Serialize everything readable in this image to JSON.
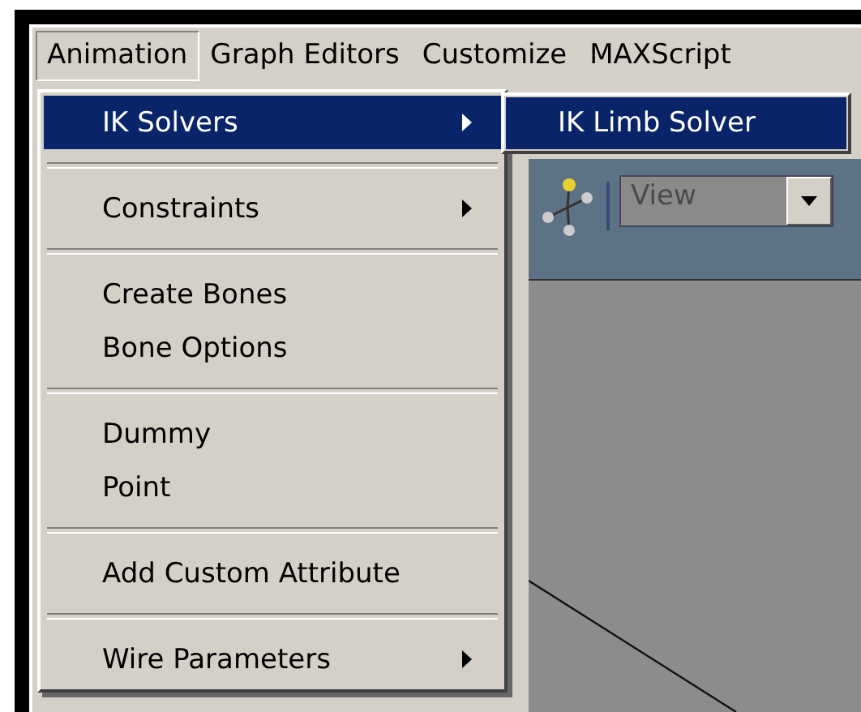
{
  "menubar": [
    {
      "label": "Animation",
      "selected": true
    },
    {
      "label": "Graph Editors",
      "selected": false
    },
    {
      "label": "Customize",
      "selected": false
    },
    {
      "label": "MAXScript",
      "selected": false
    }
  ],
  "menu": {
    "groups": [
      [
        {
          "label": "IK Solvers",
          "selected": true,
          "submenu": true
        }
      ],
      [
        {
          "label": "Constraints",
          "selected": false,
          "submenu": true
        }
      ],
      [
        {
          "label": "Create Bones",
          "selected": false,
          "submenu": false
        },
        {
          "label": "Bone Options",
          "selected": false,
          "submenu": false
        }
      ],
      [
        {
          "label": "Dummy",
          "selected": false,
          "submenu": false
        },
        {
          "label": "Point",
          "selected": false,
          "submenu": false
        }
      ],
      [
        {
          "label": "Add Custom Attribute",
          "selected": false,
          "submenu": false
        }
      ],
      [
        {
          "label": "Wire Parameters",
          "selected": false,
          "submenu": true
        }
      ]
    ]
  },
  "submenu": {
    "items": [
      {
        "label": "IK Limb Solver",
        "selected": true
      }
    ]
  },
  "viewport": {
    "view_dropdown": {
      "value": "View",
      "disabled": true
    }
  }
}
